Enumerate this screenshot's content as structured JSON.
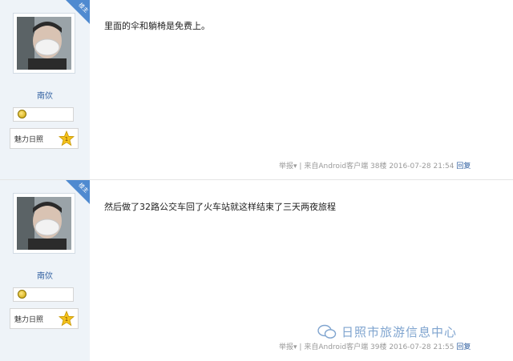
{
  "posts": [
    {
      "badge": "楼主",
      "author": "南佽",
      "charm_label": "魅力日照",
      "charm_level": "1",
      "content": "里面的伞和躺椅是免费上。",
      "report": "举报▾",
      "divider": "|",
      "source": "来自Android客户端",
      "floor": "38楼",
      "time": "2016-07-28 21:54",
      "reply": "回复"
    },
    {
      "badge": "楼主",
      "author": "南佽",
      "charm_label": "魅力日照",
      "charm_level": "1",
      "content": "然后做了32路公交车回了火车站就这样结束了三天两夜旅程",
      "report": "举报▾",
      "divider": "|",
      "source": "来自Android客户端",
      "floor": "39楼",
      "time": "2016-07-28 21:55",
      "reply": "回复"
    }
  ],
  "watermark": "日照市旅游信息中心",
  "colors": {
    "sidebar": "#eef3f8",
    "link": "#2f5fa0",
    "badge": "#4f8ad0"
  }
}
